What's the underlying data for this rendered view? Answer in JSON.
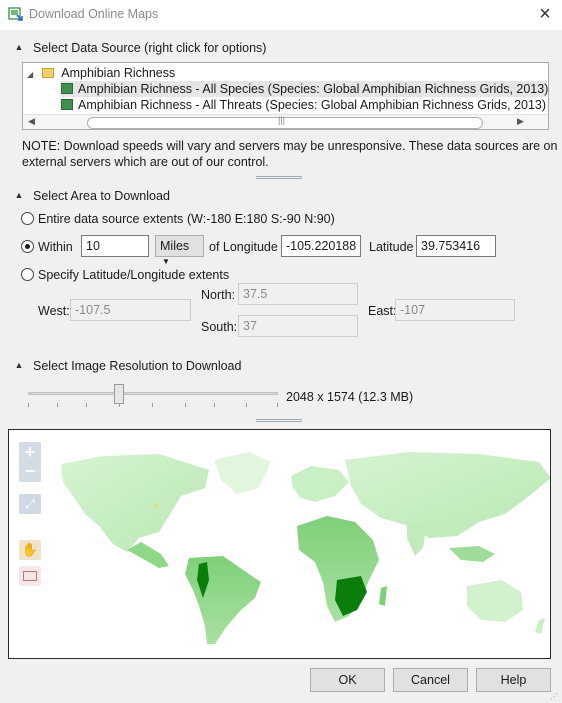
{
  "window": {
    "title": "Download Online Maps",
    "close_glyph": "×"
  },
  "data_source": {
    "section_title": "Select Data Source (right click for options)",
    "tree": {
      "group_label": "Amphibian Richness",
      "items": [
        {
          "label": "Amphibian Richness - All Species (Species: Global Amphibian Richness Grids, 2013)",
          "selected": true
        },
        {
          "label": "Amphibian Richness - All Threats (Species: Global Amphibian Richness Grids, 2013)",
          "selected": false
        }
      ]
    },
    "note_line1": "NOTE: Download speeds will vary and servers may be unresponsive.  These data sources are on",
    "note_line2": "external servers which are out of our control."
  },
  "area": {
    "section_title": "Select Area to Download",
    "option_entire": "Entire data source extents",
    "entire_extents": "(W:-180 E:180 S:-90 N:90)",
    "option_within": "Within",
    "within_value": "10",
    "unit": "Miles",
    "of_longitude_label": "of Longitude",
    "longitude_value": "-105.220188",
    "latitude_label": "Latitude",
    "latitude_value": "39.753416",
    "option_specify": "Specify Latitude/Longitude extents",
    "north_label": "North:",
    "north_value": "37.5",
    "west_label": "West:",
    "west_value": "-107.5",
    "east_label": "East:",
    "east_value": "-107",
    "south_label": "South:",
    "south_value": "37",
    "selected_option": "within"
  },
  "resolution": {
    "section_title": "Select Image Resolution to Download",
    "readout": "2048 x 1574  (12.3 MB)",
    "slider_level": 0.37
  },
  "map_tools": [
    "zoom-in-icon",
    "zoom-out-icon",
    "full-extent-icon",
    "pan-hand-icon",
    "select-rectangle-icon"
  ],
  "buttons": {
    "ok": "OK",
    "cancel": "Cancel",
    "help": "Help"
  },
  "colors": {
    "map_light": "#c9efc4",
    "map_mid": "#8fd88a",
    "map_dark": "#0b7d0b",
    "accent_tool": "#e9dcc0"
  }
}
